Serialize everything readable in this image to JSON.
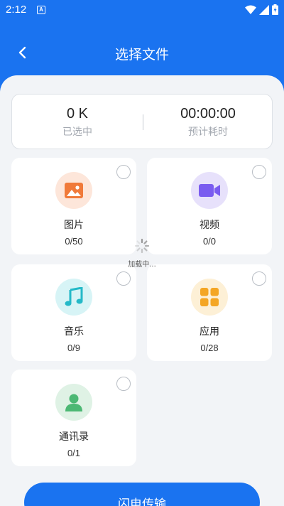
{
  "status_bar": {
    "time": "2:12",
    "notification_letter": "A"
  },
  "header": {
    "title": "选择文件"
  },
  "summary": {
    "size_value": "0 K",
    "size_label": "已选中",
    "time_value": "00:00:00",
    "time_label": "预计耗时"
  },
  "categories": [
    {
      "name": "图片",
      "count": "0/50",
      "icon": "image-icon",
      "color": "#f07a3a",
      "bg": "#fde6da"
    },
    {
      "name": "视频",
      "count": "0/0",
      "icon": "video-icon",
      "color": "#7a5cf0",
      "bg": "#e7e1fb"
    },
    {
      "name": "音乐",
      "count": "0/9",
      "icon": "music-icon",
      "color": "#24b9c8",
      "bg": "#d7f4f6"
    },
    {
      "name": "应用",
      "count": "0/28",
      "icon": "apps-icon",
      "color": "#f4a624",
      "bg": "#fdf0d6"
    },
    {
      "name": "通讯录",
      "count": "0/1",
      "icon": "contact-icon",
      "color": "#4cb874",
      "bg": "#dff2e5"
    }
  ],
  "loading": {
    "text": "加载中..."
  },
  "action": {
    "transfer_label": "闪电传输"
  },
  "colors": {
    "primary": "#1a73f0",
    "background": "#f2f4f7"
  }
}
